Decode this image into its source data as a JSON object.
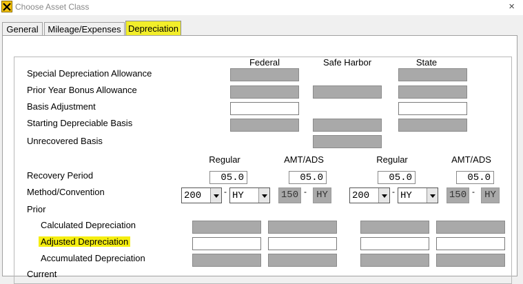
{
  "window": {
    "title": "Choose Asset Class",
    "close": "×"
  },
  "tabs": [
    {
      "label": "General"
    },
    {
      "label": "Mileage/Expenses"
    },
    {
      "label": "Depreciation"
    }
  ],
  "columns": {
    "federal": "Federal",
    "safe_harbor": "Safe Harbor",
    "state": "State"
  },
  "rows": {
    "special": "Special Depreciation Allowance",
    "prior_bonus": "Prior Year Bonus Allowance",
    "basis_adj": "Basis Adjustment",
    "starting": "Starting Depreciable Basis",
    "unrecovered": "Unrecovered Basis",
    "recovery_period": "Recovery Period",
    "method": "Method/Convention",
    "prior": "Prior",
    "calculated": "Calculated Depreciation",
    "adjusted": "Adjusted Depreciation",
    "accumulated": "Accumulated Depreciation",
    "current": "Current"
  },
  "subheaders": {
    "fed_regular": "Regular",
    "fed_amt": "AMT/ADS",
    "state_regular": "Regular",
    "state_amt": "AMT/ADS"
  },
  "recovery": {
    "fed_regular": "05.0",
    "fed_amt": "05.0",
    "state_regular": "05.0",
    "state_amt": "05.0"
  },
  "method": {
    "fed_regular_method": "200",
    "fed_regular_conv": "HY",
    "fed_amt_method": "150",
    "fed_amt_conv": "HY",
    "state_regular_method": "200",
    "state_regular_conv": "HY",
    "state_amt_method": "150",
    "state_amt_conv": "HY"
  },
  "colors": {
    "highlight": "#f2ee2a",
    "disabled_field": "#a9a9a9"
  }
}
